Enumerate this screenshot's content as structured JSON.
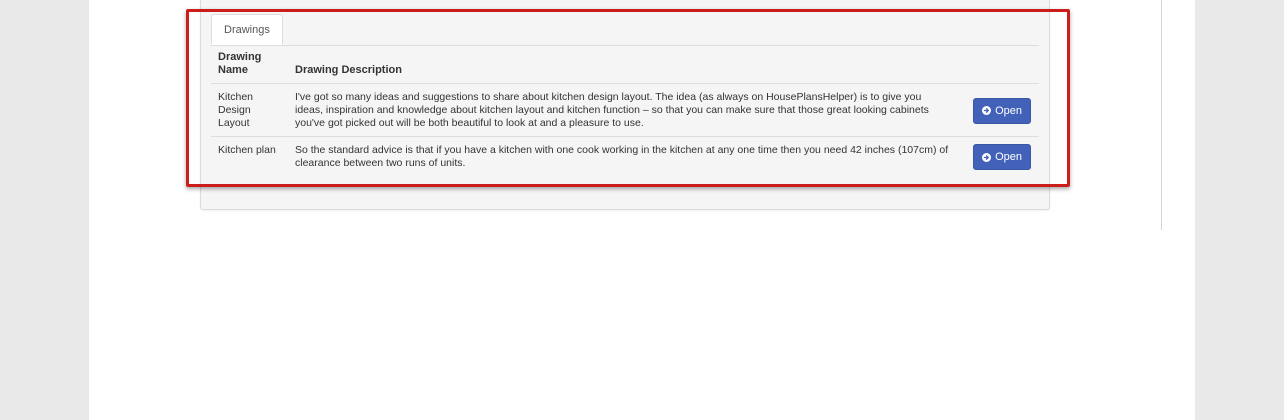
{
  "tabs": [
    {
      "label": "Drawings",
      "active": true
    }
  ],
  "table": {
    "columns": [
      "Drawing Name",
      "Drawing Description"
    ],
    "header_name_lines": [
      "Drawing",
      "Name"
    ],
    "rows": [
      {
        "name": "Kitchen Design Layout",
        "description": "I've got so many ideas and suggestions to share about kitchen design layout. The idea (as always on HousePlansHelper) is to give you ideas, inspiration and knowledge about kitchen layout and kitchen function – so that you can make sure that those great looking cabinets you've got picked out will be both beautiful to look at and a pleasure to use.",
        "action_label": "Open"
      },
      {
        "name": "Kitchen plan",
        "description": "So the standard advice is that if you have a kitchen with one cook working in the kitchen at any one time then you need 42 inches (107cm) of clearance between two runs of units.",
        "action_label": "Open"
      }
    ]
  },
  "colors": {
    "button": "#4262b9",
    "highlight": "#cc1d1d",
    "panel": "#f5f5f5"
  },
  "icons": {
    "open": "circle-arrow-right-icon"
  }
}
